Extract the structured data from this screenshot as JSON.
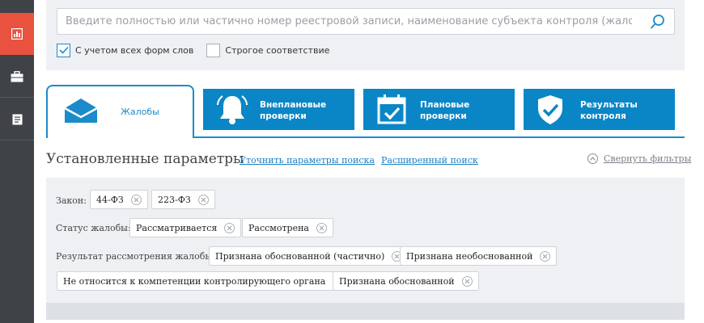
{
  "sidebar": {
    "items": [
      {
        "icon": "report-icon"
      },
      {
        "icon": "briefcase-icon"
      },
      {
        "icon": "document-icon"
      }
    ],
    "active_color": "#e8523f"
  },
  "search": {
    "placeholder": "Введите полностью или частично номер реестровой записи, наименование субъекта контроля (жалобы)/органа",
    "value": "",
    "options": {
      "all_word_forms": {
        "label": "С учетом всех форм слов",
        "checked": true
      },
      "strict_match": {
        "label": "Строгое соответствие",
        "checked": false
      }
    }
  },
  "tabs": [
    {
      "label": "Жалобы",
      "icon": "envelope-icon",
      "active": true
    },
    {
      "label": "Внеплановые проверки",
      "icon": "bell-icon",
      "active": false
    },
    {
      "label": "Плановые проверки",
      "icon": "calendar-check-icon",
      "active": false
    },
    {
      "label": "Результаты контроля",
      "icon": "shield-check-icon",
      "active": false
    }
  ],
  "params": {
    "title": "Установленные параметры",
    "refine_link": "Уточнить параметры поиска",
    "advanced_link": "Расширенный поиск",
    "collapse_label": "Свернуть фильтры"
  },
  "filters": {
    "law": {
      "label": "Закон:",
      "chips": [
        "44-ФЗ",
        "223-ФЗ"
      ]
    },
    "status": {
      "label": "Статус жалобы:",
      "chips": [
        "Рассматривается",
        "Рассмотрена"
      ]
    },
    "result": {
      "label": "Результат рассмотрения жалобы:",
      "chips": [
        "Признана обоснованной (частично)",
        "Признана необоснованной",
        "Не относится к компетенции контролирующего органа",
        "Признана обоснованной"
      ]
    }
  },
  "colors": {
    "accent": "#1b8bcb",
    "tab_bg": "#0a86c6",
    "panel_bg": "#eef0f3"
  }
}
